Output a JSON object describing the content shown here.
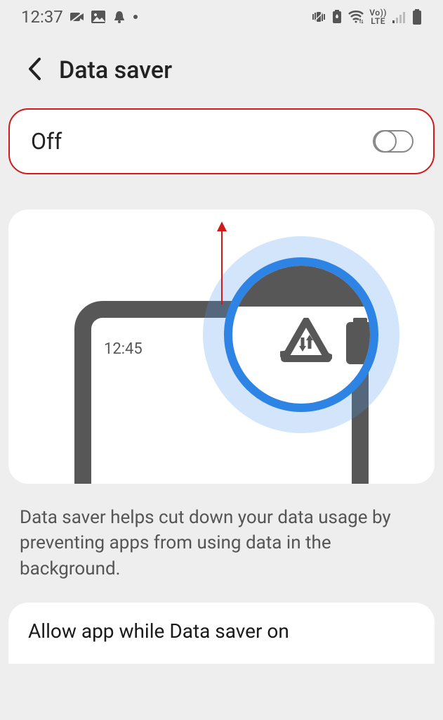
{
  "status": {
    "time": "12:37",
    "lte_top": "Vo))",
    "lte_bottom": "LTE"
  },
  "header": {
    "title": "Data saver"
  },
  "toggle": {
    "label": "Off",
    "state": false
  },
  "illustration": {
    "phone_time": "12:45"
  },
  "description": "Data saver helps cut down your data usage by preventing apps from using data in the background.",
  "allow": {
    "label": "Allow app while Data saver on"
  },
  "annotation": {
    "highlight_color": "#d11a1a"
  }
}
